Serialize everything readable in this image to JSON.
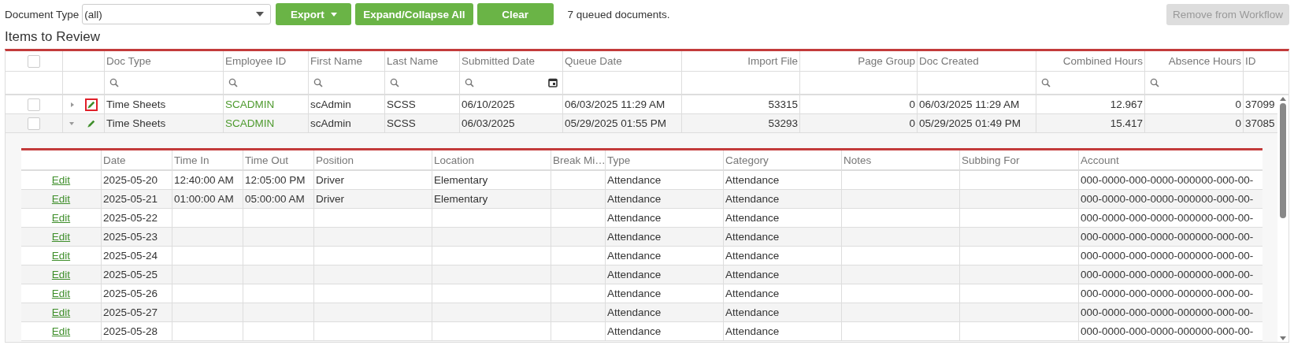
{
  "toolbar": {
    "document_type_label": "Document Type",
    "document_type_value": "(all)",
    "buttons": [
      {
        "label": "Export",
        "kind": "dropdown"
      },
      {
        "label": "Expand/Collapse All",
        "kind": "plain"
      },
      {
        "label": "Clear",
        "kind": "plain"
      }
    ],
    "queued_text": "7 queued documents.",
    "remove_button": {
      "label": "Remove from Workflow",
      "disabled": true
    }
  },
  "section_title": "Items to Review",
  "grid": {
    "select_all_checked": false,
    "columns": [
      {
        "label": "Doc Type",
        "kind": "text"
      },
      {
        "label": "Employee ID",
        "kind": "link"
      },
      {
        "label": "First Name",
        "kind": "text"
      },
      {
        "label": "Last Name",
        "kind": "text"
      },
      {
        "label": "Submitted Date",
        "kind": "date"
      },
      {
        "label": "Queue Date",
        "kind": "plain"
      },
      {
        "label": "Import File",
        "kind": "number"
      },
      {
        "label": "Page Group",
        "kind": "number"
      },
      {
        "label": "Doc Created",
        "kind": "plain"
      },
      {
        "label": "Combined Hours",
        "kind": "measure"
      },
      {
        "label": "Absence Hours",
        "kind": "measure"
      },
      {
        "label": "ID",
        "kind": "plain"
      }
    ],
    "rows": [
      {
        "checked": false,
        "expanded": false,
        "highlighted": true,
        "cells": [
          "Time Sheets",
          "SCADMIN",
          "scAdmin",
          "SCSS",
          "06/10/2025",
          "06/03/2025 11:29 AM",
          "53315",
          "0",
          "06/03/2025 11:29 AM",
          "12.967",
          "0",
          "37099"
        ]
      },
      {
        "checked": false,
        "expanded": true,
        "highlighted": false,
        "cells": [
          "Time Sheets",
          "SCADMIN",
          "scAdmin",
          "SCSS",
          "06/03/2025",
          "05/29/2025 01:55 PM",
          "53293",
          "0",
          "05/29/2025 01:49 PM",
          "15.417",
          "0",
          "37085"
        ]
      }
    ]
  },
  "detail": {
    "columns": [
      "Date",
      "Time In",
      "Time Out",
      "Position",
      "Location",
      "Break Mi…",
      "Type",
      "Category",
      "Notes",
      "Subbing For",
      "Account"
    ],
    "rows": [
      {
        "action": "Edit",
        "cells": [
          "2025-05-20",
          "12:40:00 AM",
          "12:05:00 PM",
          "Driver",
          "Elementary",
          null,
          "Attendance",
          "Attendance",
          null,
          null,
          "000-0000-000-0000-000000-000-00-"
        ]
      },
      {
        "action": "Edit",
        "cells": [
          "2025-05-21",
          "01:00:00 AM",
          "05:00:00 AM",
          "Driver",
          "Elementary",
          null,
          "Attendance",
          "Attendance",
          null,
          null,
          "000-0000-000-0000-000000-000-00-"
        ]
      },
      {
        "action": "Edit",
        "cells": [
          "2025-05-22",
          null,
          null,
          null,
          null,
          null,
          "Attendance",
          "Attendance",
          null,
          null,
          "000-0000-000-0000-000000-000-00-"
        ]
      },
      {
        "action": "Edit",
        "cells": [
          "2025-05-23",
          null,
          null,
          null,
          null,
          null,
          "Attendance",
          "Attendance",
          null,
          null,
          "000-0000-000-0000-000000-000-00-"
        ]
      },
      {
        "action": "Edit",
        "cells": [
          "2025-05-24",
          null,
          null,
          null,
          null,
          null,
          "Attendance",
          "Attendance",
          null,
          null,
          "000-0000-000-0000-000000-000-00-"
        ]
      },
      {
        "action": "Edit",
        "cells": [
          "2025-05-25",
          null,
          null,
          null,
          null,
          null,
          "Attendance",
          "Attendance",
          null,
          null,
          "000-0000-000-0000-000000-000-00-"
        ]
      },
      {
        "action": "Edit",
        "cells": [
          "2025-05-26",
          null,
          null,
          null,
          null,
          null,
          "Attendance",
          "Attendance",
          null,
          null,
          "000-0000-000-0000-000000-000-00-"
        ]
      },
      {
        "action": "Edit",
        "cells": [
          "2025-05-27",
          null,
          null,
          null,
          null,
          null,
          "Attendance",
          "Attendance",
          null,
          null,
          "000-0000-000-0000-000000-000-00-"
        ]
      },
      {
        "action": "Edit",
        "cells": [
          "2025-05-28",
          null,
          null,
          null,
          null,
          null,
          "Attendance",
          "Attendance",
          null,
          null,
          "000-0000-000-0000-000000-000-00-"
        ]
      }
    ]
  }
}
